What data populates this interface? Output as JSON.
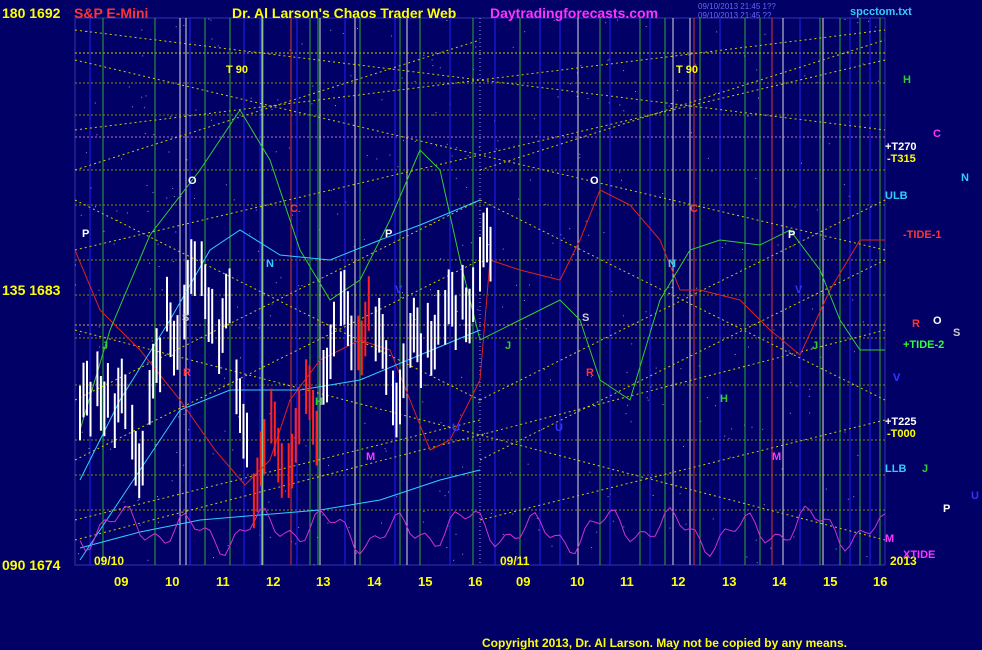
{
  "header": {
    "symbol": "S&P E-Mini",
    "title": "Dr. Al Larson's Chaos Trader Web",
    "site": "Daytradingforecasts.com",
    "stamp1": "09/10/2013 21:45 1??",
    "stamp2": "09/10/2013 21:45 ??",
    "file": "spcctom.txt"
  },
  "y_axis": {
    "top": "180  1692",
    "mid": "135  1683",
    "bottom": "090  1674"
  },
  "x_axis": {
    "day1_hours": [
      "09",
      "10",
      "11",
      "12",
      "13",
      "14",
      "15",
      "16"
    ],
    "day2_hours": [
      "09",
      "10",
      "11",
      "12",
      "13",
      "14",
      "15",
      "16"
    ],
    "date1": "09/10",
    "date2": "09/11",
    "year": "2013"
  },
  "footer": {
    "copyright": "Copyright 2013, Dr. Al Larson. May not be copied by any means."
  },
  "right_labels": [
    {
      "text": "H",
      "color": "#33cc33"
    },
    {
      "text": "C",
      "color": "#ff33ff"
    },
    {
      "text": "+T270",
      "color": "#ffffff"
    },
    {
      "text": "-T315",
      "color": "#ffff00"
    },
    {
      "text": "N",
      "color": "#33ccff"
    },
    {
      "text": "ULB",
      "color": "#33ccff"
    },
    {
      "text": "-TIDE-1",
      "color": "#ff3333"
    },
    {
      "text": "R",
      "color": "#ff3333"
    },
    {
      "text": "O",
      "color": "#ffffff"
    },
    {
      "text": "S",
      "color": "#cccccc"
    },
    {
      "text": "+TIDE-2",
      "color": "#33ff33"
    },
    {
      "text": "V",
      "color": "#3333ff"
    },
    {
      "text": "+T225",
      "color": "#ffffff"
    },
    {
      "text": "-T000",
      "color": "#ffff00"
    },
    {
      "text": "LLB",
      "color": "#33ccff"
    },
    {
      "text": "J",
      "color": "#33cc33"
    },
    {
      "text": "U",
      "color": "#3333ff"
    },
    {
      "text": "P",
      "color": "#ffffff"
    },
    {
      "text": "M",
      "color": "#ff33ff"
    },
    {
      "text": "XTIDE",
      "color": "#ff33ff"
    }
  ],
  "chart_labels": [
    {
      "text": "T    90",
      "color": "#ffff00"
    },
    {
      "text": "T    90",
      "color": "#ffff00"
    },
    {
      "text": "O",
      "color": "#ffffff"
    },
    {
      "text": "O",
      "color": "#ffffff"
    },
    {
      "text": "C",
      "color": "#ff3333"
    },
    {
      "text": "C",
      "color": "#ff3333"
    },
    {
      "text": "P",
      "color": "#ffffff"
    },
    {
      "text": "P",
      "color": "#ffffff"
    },
    {
      "text": "P",
      "color": "#ffffff"
    },
    {
      "text": "N",
      "color": "#33ccff"
    },
    {
      "text": "N",
      "color": "#33ccff"
    },
    {
      "text": "V",
      "color": "#3333ff"
    },
    {
      "text": "V",
      "color": "#3333ff"
    },
    {
      "text": "S",
      "color": "#cccccc"
    },
    {
      "text": "S",
      "color": "#cccccc"
    },
    {
      "text": "J",
      "color": "#33cc33"
    },
    {
      "text": "J",
      "color": "#33cc33"
    },
    {
      "text": "J",
      "color": "#33cc33"
    },
    {
      "text": "H",
      "color": "#33cc33"
    },
    {
      "text": "H",
      "color": "#33cc33"
    },
    {
      "text": "M",
      "color": "#ff33ff"
    },
    {
      "text": "M",
      "color": "#ff33ff"
    },
    {
      "text": "R",
      "color": "#ff3333"
    },
    {
      "text": "R",
      "color": "#ff3333"
    },
    {
      "text": "U",
      "color": "#3333ff"
    },
    {
      "text": "U",
      "color": "#3333ff"
    },
    {
      "text": "V",
      "color": "#3333ff"
    }
  ],
  "chart_data": {
    "type": "line",
    "y_scale": {
      "top": 1692,
      "mid": 1683,
      "bottom": 1674,
      "angle_top": 180,
      "angle_mid": 135,
      "angle_bottom": 90
    },
    "price_bars_day1": {
      "description": "intraday S&P E-mini price bars, session 09/10",
      "approx_close_path": [
        1679,
        1680,
        1679,
        1678,
        1680,
        1682,
        1683,
        1683,
        1682,
        1679,
        1677,
        1678,
        1678,
        1679,
        1681,
        1682,
        1682,
        1681,
        1680,
        1681,
        1682,
        1682,
        1683,
        1684
      ]
    },
    "series": [
      {
        "name": "-TIDE-1",
        "color": "#ff3333"
      },
      {
        "name": "+TIDE-2",
        "color": "#33ff33"
      },
      {
        "name": "ULB",
        "color": "#33ccff"
      },
      {
        "name": "LLB",
        "color": "#33ccff"
      },
      {
        "name": "XTIDE",
        "color": "#ff33ff"
      }
    ]
  }
}
